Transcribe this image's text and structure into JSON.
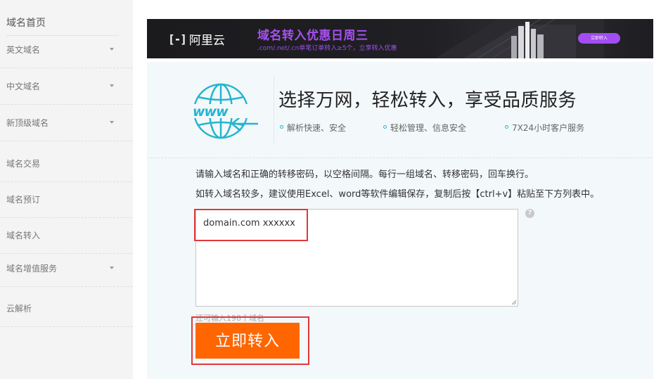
{
  "sidebar": {
    "home": "域名首页",
    "items": [
      {
        "label": "英文域名",
        "has_arrow": true
      },
      {
        "label": "中文域名",
        "has_arrow": true
      },
      {
        "label": "新顶级域名",
        "has_arrow": true
      },
      {
        "label": "域名交易",
        "has_arrow": false
      },
      {
        "label": "域名预订",
        "has_arrow": false
      },
      {
        "label": "域名转入",
        "has_arrow": false
      },
      {
        "label": "域名增值服务",
        "has_arrow": true
      },
      {
        "label": "云解析",
        "has_arrow": false
      }
    ]
  },
  "banner": {
    "logo_mark": "[-]",
    "brand": "阿里云",
    "title": "域名转入优惠日周三",
    "subtitle": ".com/.net/.cn单笔订单转入≥5个，立享转入优惠",
    "button": "立即转入"
  },
  "hero": {
    "icon": "globe-www-icon",
    "headline": "选择万网，轻松转入，享受品质服务",
    "features": [
      "解析快速、安全",
      "轻松管理、信息安全",
      "7X24小时客户服务"
    ]
  },
  "form": {
    "instruction_1": "请输入域名和正确的转移密码，以空格间隔。每行一组域名、转移密码，回车换行。",
    "instruction_2": "如转入域名较多，建议使用Excel、word等软件编辑保存，复制后按【ctrl+v】粘贴至下方列表中。",
    "textarea_value": "domain.com xxxxxx",
    "help": "?",
    "remaining": "还可输入198个域名",
    "submit_label": "立即转入"
  },
  "colors": {
    "accent_orange": "#ff6600",
    "highlight_red": "#e0383b",
    "banner_purple": "#a74ff0",
    "globe_teal": "#25b5d0"
  }
}
